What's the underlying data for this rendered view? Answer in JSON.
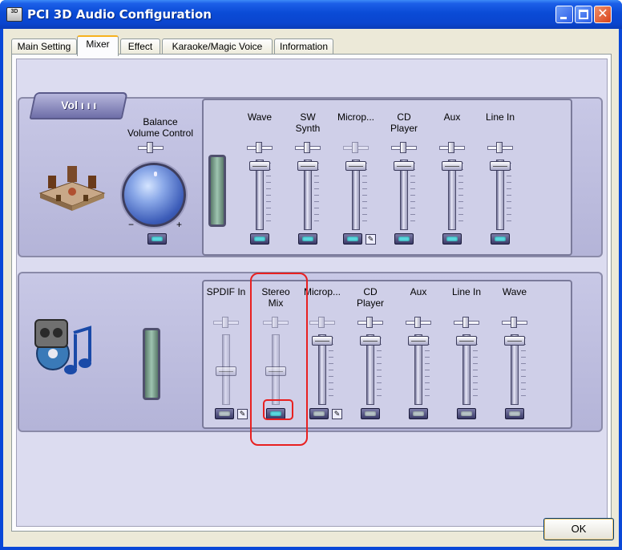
{
  "window": {
    "title": "PCI 3D Audio Configuration",
    "icon_text": "3D",
    "close_glyph": "✕"
  },
  "tabs": [
    {
      "label": "Main Setting",
      "active": false
    },
    {
      "label": "Mixer",
      "active": true
    },
    {
      "label": "Effect",
      "active": false
    },
    {
      "label": "Karaoke/Magic Voice",
      "active": false
    },
    {
      "label": "Information",
      "active": false
    }
  ],
  "playback": {
    "badge": "Vol ı ı ı",
    "balance_label_line1": "Balance",
    "balance_label_line2": "Volume Control",
    "knob_minus": "−",
    "knob_plus": "+",
    "channels": [
      {
        "label": "Wave",
        "label2": ""
      },
      {
        "label": "SW",
        "label2": "Synth"
      },
      {
        "label": "Microp...",
        "label2": ""
      },
      {
        "label": "CD",
        "label2": "Player"
      },
      {
        "label": "Aux",
        "label2": ""
      },
      {
        "label": "Line In",
        "label2": ""
      }
    ]
  },
  "recording": {
    "channels": [
      {
        "label": "SPDIF In",
        "label2": ""
      },
      {
        "label": "Stereo",
        "label2": "Mix"
      },
      {
        "label": "Microp...",
        "label2": ""
      },
      {
        "label": "CD",
        "label2": "Player"
      },
      {
        "label": "Aux",
        "label2": ""
      },
      {
        "label": "Line In",
        "label2": ""
      },
      {
        "label": "Wave",
        "label2": ""
      }
    ]
  },
  "footer": {
    "ok_label": "OK"
  },
  "colors": {
    "titlebar": "#0a45cf",
    "highlight": "#e82020",
    "panel": "#c8c8e6"
  }
}
